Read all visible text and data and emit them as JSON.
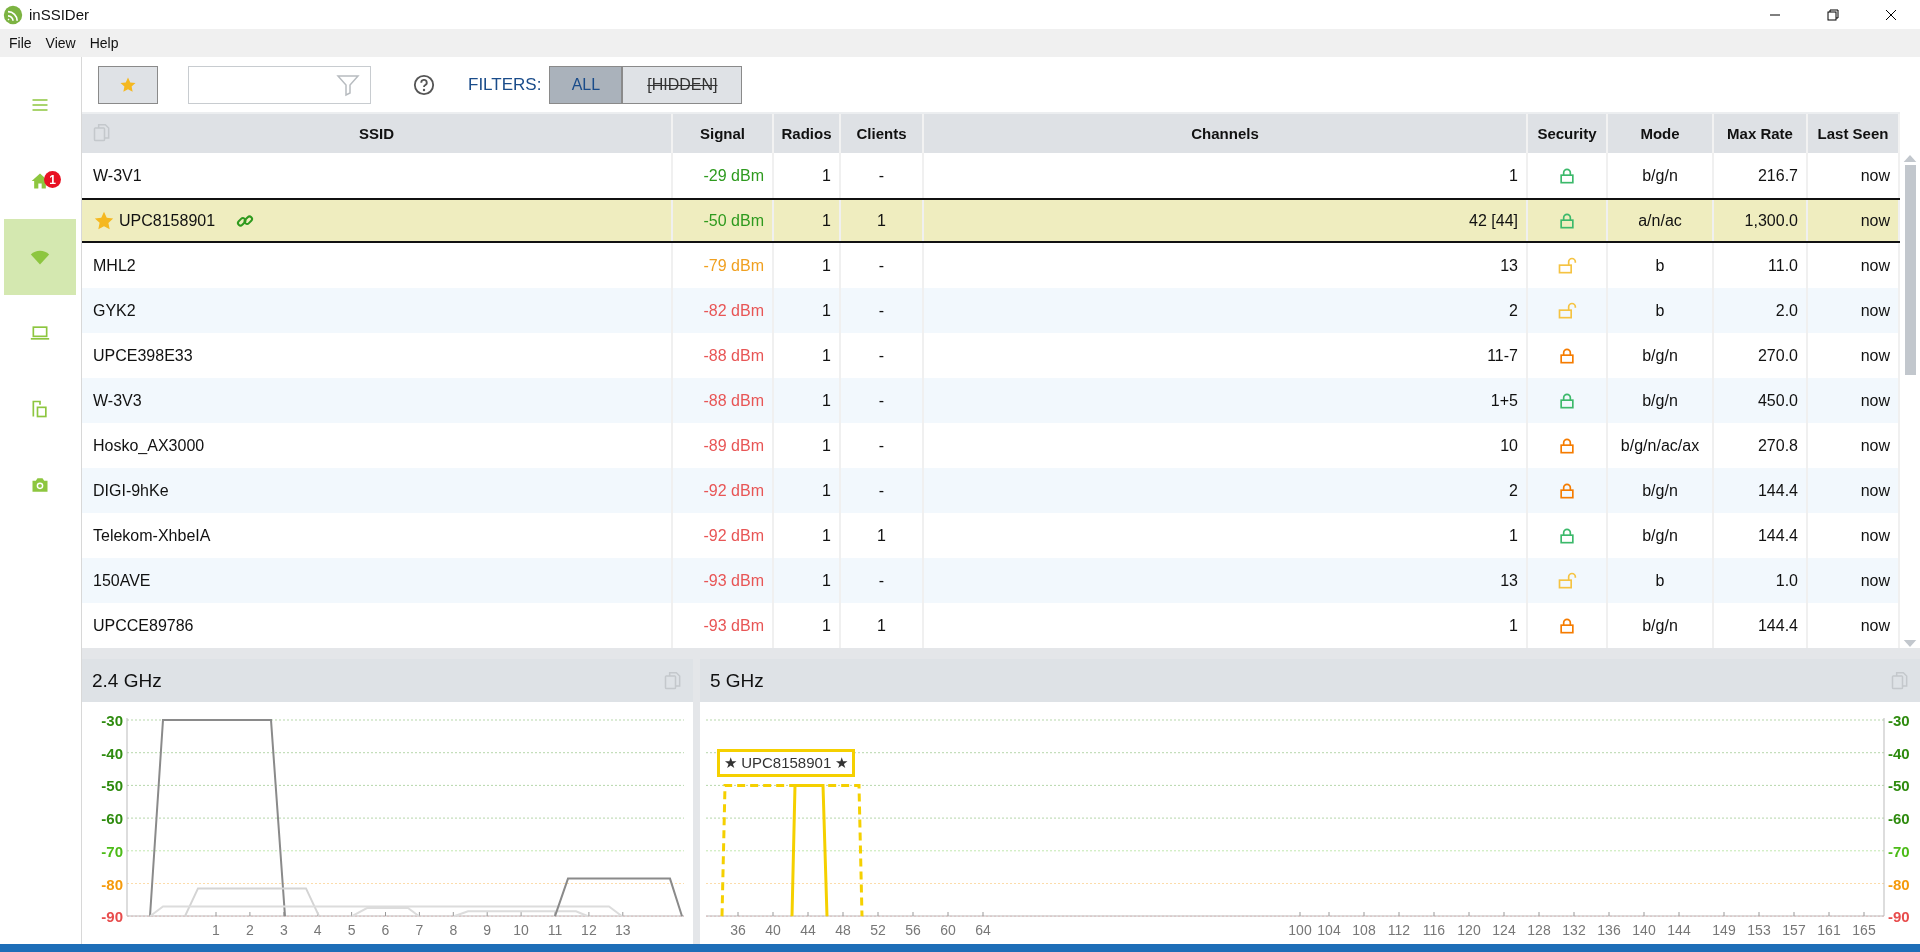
{
  "window": {
    "title": "inSSIDer"
  },
  "menu": [
    "File",
    "View",
    "Help"
  ],
  "sidebar": {
    "items": [
      {
        "kind": "menu",
        "selected": false
      },
      {
        "kind": "home",
        "badge": "1",
        "selected": false
      },
      {
        "kind": "wifi",
        "selected": true
      },
      {
        "kind": "laptop",
        "selected": false
      },
      {
        "kind": "pages",
        "selected": false
      },
      {
        "kind": "camera",
        "selected": false
      }
    ]
  },
  "toolbar": {
    "filters_label": "FILTERS:",
    "filters": [
      {
        "label": "ALL",
        "selected": true
      },
      {
        "label": "[HIDDEN]",
        "selected": false
      }
    ]
  },
  "table": {
    "columns": [
      "SSID",
      "Signal",
      "Radios",
      "Clients",
      "Channels",
      "Security",
      "Mode",
      "Max Rate",
      "Last Seen"
    ],
    "rows": [
      {
        "ssid": "W-3V1",
        "starred": false,
        "connected": false,
        "signal": "-29 dBm",
        "color": "#2e9a1e",
        "radios": "1",
        "clients": "-",
        "channels": "1",
        "security": {
          "kind": "locked",
          "color": "#3cb96b"
        },
        "mode": "b/g/n",
        "max_rate": "216.7",
        "last_seen": "now",
        "selected": false
      },
      {
        "ssid": "UPC8158901",
        "starred": true,
        "connected": true,
        "signal": "-50 dBm",
        "color": "#2e9a1e",
        "radios": "1",
        "clients": "1",
        "channels": "42 [44]",
        "security": {
          "kind": "locked",
          "color": "#3cb96b"
        },
        "mode": "a/n/ac",
        "max_rate": "1,300.0",
        "last_seen": "now",
        "selected": true
      },
      {
        "ssid": "MHL2",
        "starred": false,
        "connected": false,
        "signal": "-79 dBm",
        "color": "#f0a020",
        "radios": "1",
        "clients": "-",
        "channels": "13",
        "security": {
          "kind": "unlocked",
          "color": "#f5c342"
        },
        "mode": "b",
        "max_rate": "11.0",
        "last_seen": "now",
        "selected": false
      },
      {
        "ssid": "GYK2",
        "starred": false,
        "connected": false,
        "signal": "-82 dBm",
        "color": "#e85555",
        "radios": "1",
        "clients": "-",
        "channels": "2",
        "security": {
          "kind": "unlocked",
          "color": "#f5c342"
        },
        "mode": "b",
        "max_rate": "2.0",
        "last_seen": "now",
        "selected": false
      },
      {
        "ssid": "UPCE398E33",
        "starred": false,
        "connected": false,
        "signal": "-88 dBm",
        "color": "#e85555",
        "radios": "1",
        "clients": "-",
        "channels": "11-7",
        "security": {
          "kind": "locked",
          "color": "#f57c00"
        },
        "mode": "b/g/n",
        "max_rate": "270.0",
        "last_seen": "now",
        "selected": false
      },
      {
        "ssid": "W-3V3",
        "starred": false,
        "connected": false,
        "signal": "-88 dBm",
        "color": "#e85555",
        "radios": "1",
        "clients": "-",
        "channels": "1+5",
        "security": {
          "kind": "locked",
          "color": "#3cb96b"
        },
        "mode": "b/g/n",
        "max_rate": "450.0",
        "last_seen": "now",
        "selected": false
      },
      {
        "ssid": "Hosko_AX3000",
        "starred": false,
        "connected": false,
        "signal": "-89 dBm",
        "color": "#e85555",
        "radios": "1",
        "clients": "-",
        "channels": "10",
        "security": {
          "kind": "locked",
          "color": "#f57c00"
        },
        "mode": "b/g/n/ac/ax",
        "max_rate": "270.8",
        "last_seen": "now",
        "selected": false
      },
      {
        "ssid": "DIGI-9hKe",
        "starred": false,
        "connected": false,
        "signal": "-92 dBm",
        "color": "#e85555",
        "radios": "1",
        "clients": "-",
        "channels": "2",
        "security": {
          "kind": "locked",
          "color": "#f57c00"
        },
        "mode": "b/g/n",
        "max_rate": "144.4",
        "last_seen": "now",
        "selected": false
      },
      {
        "ssid": "Telekom-XhbeIA",
        "starred": false,
        "connected": false,
        "signal": "-92 dBm",
        "color": "#e85555",
        "radios": "1",
        "clients": "1",
        "channels": "1",
        "security": {
          "kind": "locked",
          "color": "#3cb96b"
        },
        "mode": "b/g/n",
        "max_rate": "144.4",
        "last_seen": "now",
        "selected": false
      },
      {
        "ssid": "150AVE",
        "starred": false,
        "connected": false,
        "signal": "-93 dBm",
        "color": "#e85555",
        "radios": "1",
        "clients": "-",
        "channels": "13",
        "security": {
          "kind": "unlocked",
          "color": "#f5c342"
        },
        "mode": "b",
        "max_rate": "1.0",
        "last_seen": "now",
        "selected": false
      },
      {
        "ssid": "UPCCE89786",
        "starred": false,
        "connected": false,
        "signal": "-93 dBm",
        "color": "#e85555",
        "radios": "1",
        "clients": "1",
        "channels": "1",
        "security": {
          "kind": "locked",
          "color": "#f57c00"
        },
        "mode": "b/g/n",
        "max_rate": "144.4",
        "last_seen": "now",
        "selected": false
      }
    ]
  },
  "charts": [
    {
      "title": "2.4 GHz",
      "y_labels": [
        {
          "text": "-30",
          "color": "#2e8b0e"
        },
        {
          "text": "-40",
          "color": "#2e8b0e"
        },
        {
          "text": "-50",
          "color": "#2e8b0e"
        },
        {
          "text": "-60",
          "color": "#2e8b0e"
        },
        {
          "text": "-70",
          "color": "#4cbb17"
        },
        {
          "text": "-80",
          "color": "#f59a0b"
        },
        {
          "text": "-90",
          "color": "#e84c4c"
        }
      ],
      "x_labels": [
        "1",
        "2",
        "3",
        "4",
        "5",
        "6",
        "7",
        "8",
        "9",
        "10",
        "11",
        "12",
        "13"
      ]
    },
    {
      "title": "5 GHz",
      "highlight_label": "★ UPC8158901 ★",
      "y_labels": [
        {
          "text": "-30",
          "color": "#2e8b0e"
        },
        {
          "text": "-40",
          "color": "#2e8b0e"
        },
        {
          "text": "-50",
          "color": "#2e8b0e"
        },
        {
          "text": "-60",
          "color": "#2e8b0e"
        },
        {
          "text": "-70",
          "color": "#4cbb17"
        },
        {
          "text": "-80",
          "color": "#f59a0b"
        },
        {
          "text": "-90",
          "color": "#e84c4c"
        }
      ],
      "x_labels": [
        "36",
        "40",
        "44",
        "48",
        "52",
        "56",
        "60",
        "64",
        "100",
        "104",
        "108",
        "112",
        "116",
        "120",
        "124",
        "128",
        "132",
        "136",
        "140",
        "144",
        "149",
        "153",
        "157",
        "161",
        "165"
      ]
    }
  ]
}
